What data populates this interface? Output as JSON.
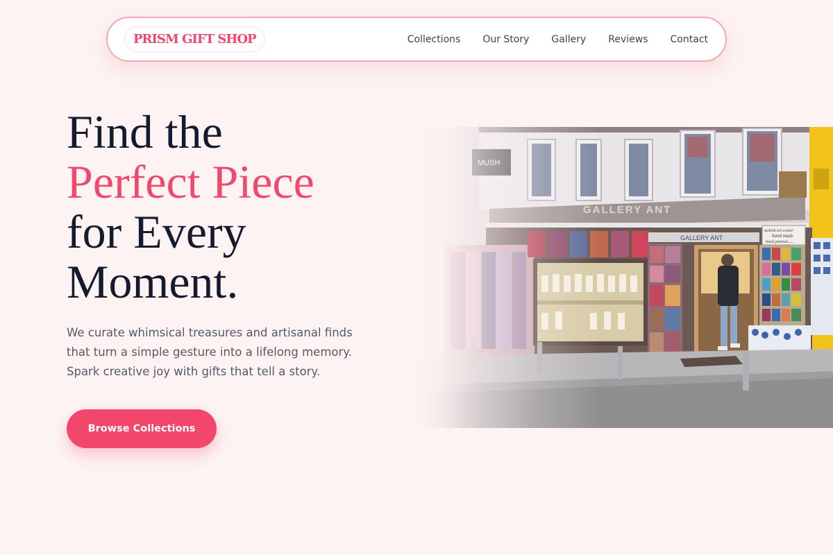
{
  "brand": {
    "name": "PRISM GIFT SHOP",
    "accent_color": "#f2476a",
    "text_color": "#141b2e",
    "background_color": "#fdf3f3"
  },
  "nav": {
    "links": [
      "Collections",
      "Our Story",
      "Gallery",
      "Reviews",
      "Contact"
    ]
  },
  "hero": {
    "title_lines": [
      "Find the",
      "Perfect Piece",
      "for Every",
      "Moment."
    ],
    "description_lines": [
      "We curate whimsical treasures and artisanal finds",
      "that turn a simple gesture into a lifelong memory.",
      "Spark creative joy with gifts that tell a story."
    ],
    "cta_label": "Browse Collections"
  },
  "image": {
    "subject": "gift-shop-storefront",
    "signs": {
      "top_sign": "MUSH",
      "awning_sign": "GALLERY ANT",
      "window_sign": "GALLERY ANT",
      "board_line_1": "turkish art center",
      "board_line_2": "hand made",
      "board_line_3": "hand painted......"
    }
  }
}
